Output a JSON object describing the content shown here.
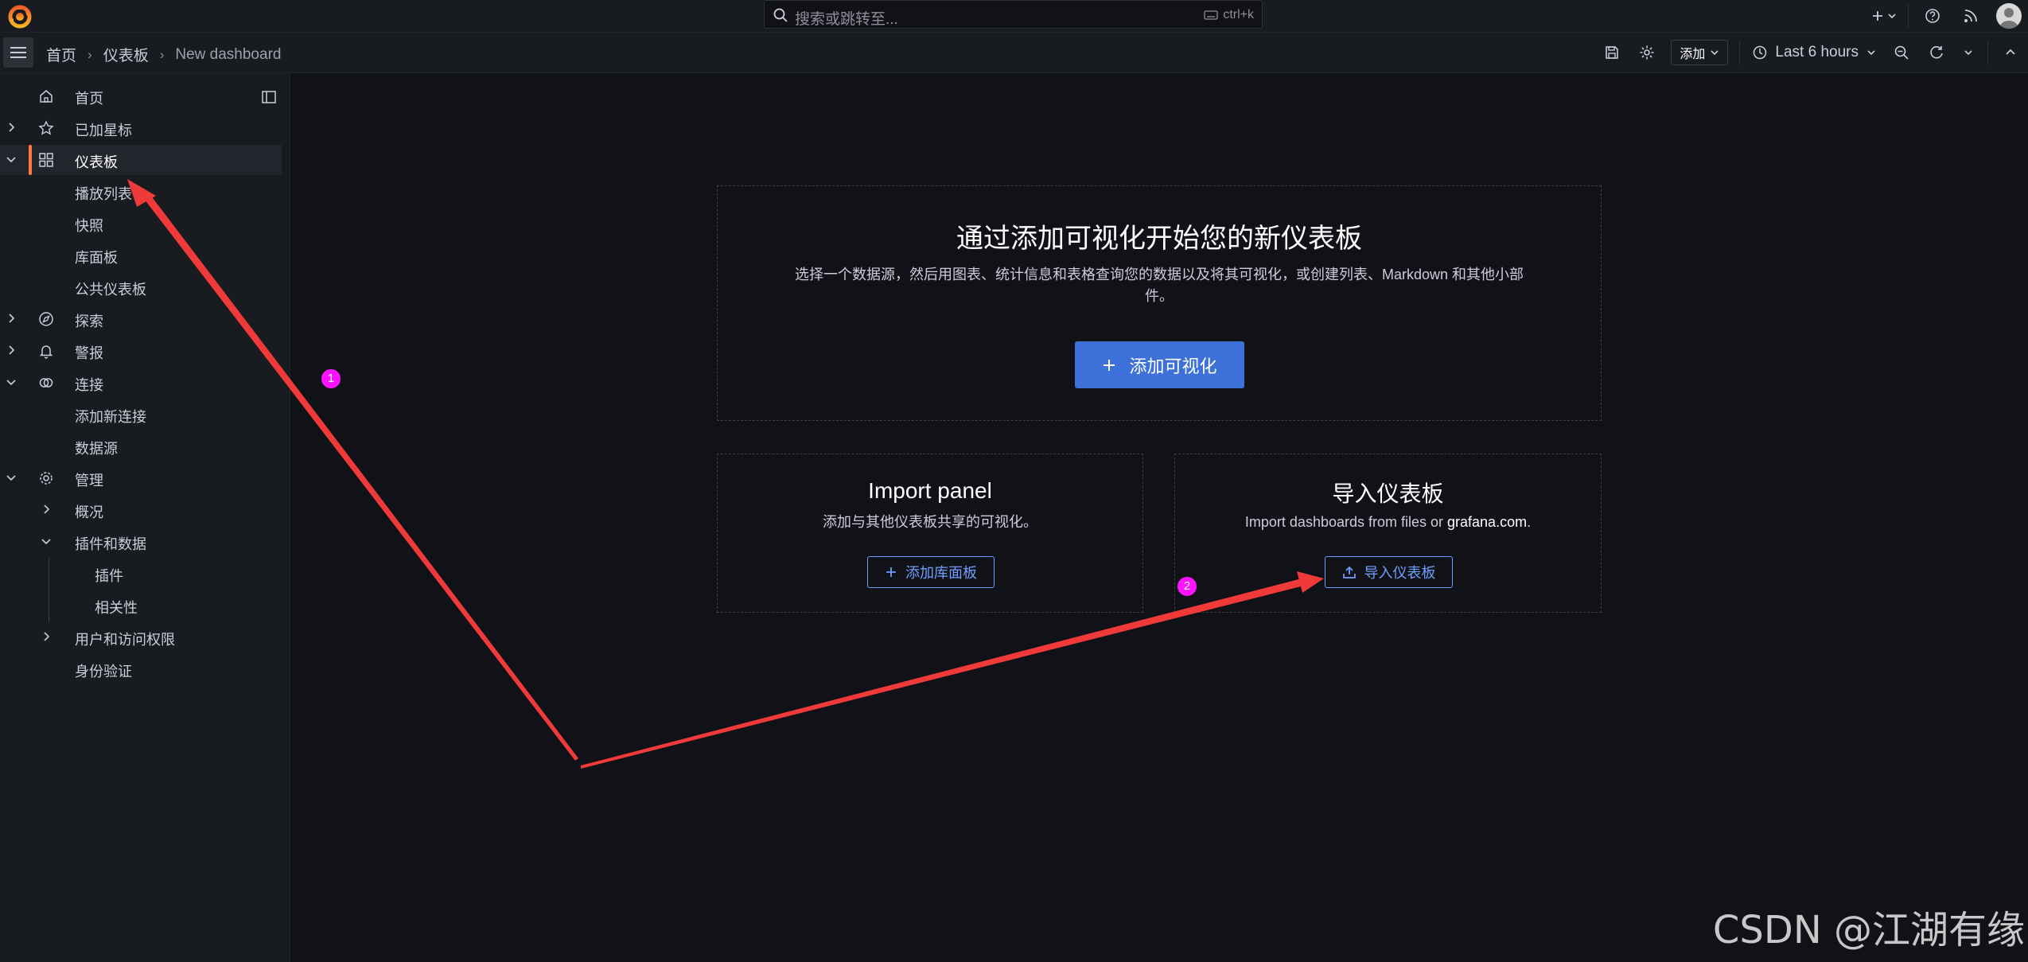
{
  "topbar": {
    "search_placeholder": "搜索或跳转至...",
    "shortcut": "ctrl+k"
  },
  "breadcrumbs": [
    "首页",
    "仪表板",
    "New dashboard"
  ],
  "toolbar": {
    "add_label": "添加",
    "time_range": "Last 6 hours"
  },
  "sidebar": {
    "items": [
      {
        "label": "首页"
      },
      {
        "label": "已加星标"
      },
      {
        "label": "仪表板"
      },
      {
        "label": "播放列表"
      },
      {
        "label": "快照"
      },
      {
        "label": "库面板"
      },
      {
        "label": "公共仪表板"
      },
      {
        "label": "探索"
      },
      {
        "label": "警报"
      },
      {
        "label": "连接"
      },
      {
        "label": "添加新连接"
      },
      {
        "label": "数据源"
      },
      {
        "label": "管理"
      },
      {
        "label": "概况"
      },
      {
        "label": "插件和数据"
      },
      {
        "label": "插件"
      },
      {
        "label": "相关性"
      },
      {
        "label": "用户和访问权限"
      },
      {
        "label": "身份验证"
      }
    ]
  },
  "main": {
    "visualization_card": {
      "title": "通过添加可视化开始您的新仪表板",
      "desc_line1": "选择一个数据源，然后用图表、统计信息和表格查询您的数据以及将其可视化，或创建列表、Markdown 和其他小部",
      "desc_line2": "件。",
      "button": "添加可视化"
    },
    "import_panel_card": {
      "title": "Import panel",
      "desc": "添加与其他仪表板共享的可视化。",
      "button": "添加库面板"
    },
    "import_dashboard_card": {
      "title": "导入仪表板",
      "desc_prefix": "Import dashboards from files or ",
      "desc_link": "grafana.com",
      "desc_suffix": ".",
      "button": "导入仪表板"
    }
  },
  "annotations": {
    "badge1": "1",
    "badge2": "2",
    "arrow_color": "#f03a3a",
    "badge_color": "#ff12ff"
  },
  "watermark": "CSDN @江湖有缘",
  "colors": {
    "accent": "#3d71d9",
    "active_marker": "#ff7941",
    "background": "#111217",
    "panel": "#181b1f"
  }
}
